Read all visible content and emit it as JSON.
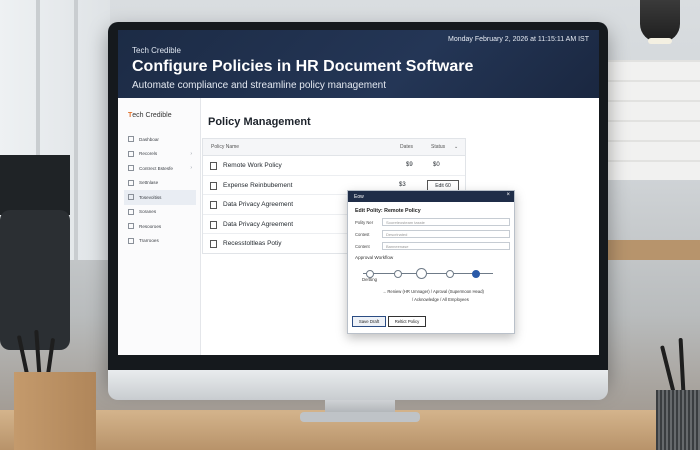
{
  "banner": {
    "brand": "Tech Credible",
    "datetime": "Monday February 2, 2026 at 11:15:11 AM IST",
    "headline": "Configure Policies in HR Document Software",
    "subline": "Automate compliance and streamline policy management"
  },
  "sidebar": {
    "logo_mark": "T",
    "logo_text": "ech Credible",
    "items": [
      {
        "label": "Dashboar",
        "chevron": false
      },
      {
        "label": "Recorels",
        "chevron": true
      },
      {
        "label": "Contrect Bstesfe",
        "chevron": true
      },
      {
        "label": "Settnlase",
        "chevron": false
      },
      {
        "label": "Tosevoltiss",
        "chevron": false
      },
      {
        "label": "Soranes",
        "chevron": false
      },
      {
        "label": "Resooroes",
        "chevron": false
      },
      {
        "label": "Trarrooes",
        "chevron": false
      }
    ]
  },
  "main": {
    "title": "Policy Management",
    "table": {
      "headers": {
        "name": "Policy Name",
        "dates": "Dates",
        "status": "Status"
      },
      "rows": [
        {
          "name": "Remote Work Policy",
          "dates": "$9",
          "status": "$0"
        },
        {
          "name": "Expense Reinbubement",
          "dates": "$3",
          "action": "Edit 60"
        },
        {
          "name": "Data Privacy Agreement",
          "dates": "",
          "status": ""
        },
        {
          "name": "Data Privacy Agreement",
          "dates": "",
          "status": ""
        },
        {
          "name": "Recesstoltleas Potiy",
          "dates": "",
          "status": ""
        }
      ]
    }
  },
  "modal": {
    "header": "Eow",
    "close": "×",
    "title": "Edit Polity: Remote Policy",
    "fields": [
      {
        "label": "Polity Ner",
        "placeholder": "Sooreteosteam tasste"
      },
      {
        "label": "Contest",
        "placeholder": "Descrinated"
      },
      {
        "label": "Content",
        "placeholder": "Banneenase"
      }
    ],
    "workflow_label": "Approval Workflow",
    "workflow_start": "Dertting",
    "workflow_note_1": "→ Reniew (HR Umnager) / Aproval (Supermoon Head)",
    "workflow_note_2": "/ Acknowledge / All Employees",
    "save_label": "Save Draft",
    "reject_label": "Reltict Policy"
  }
}
